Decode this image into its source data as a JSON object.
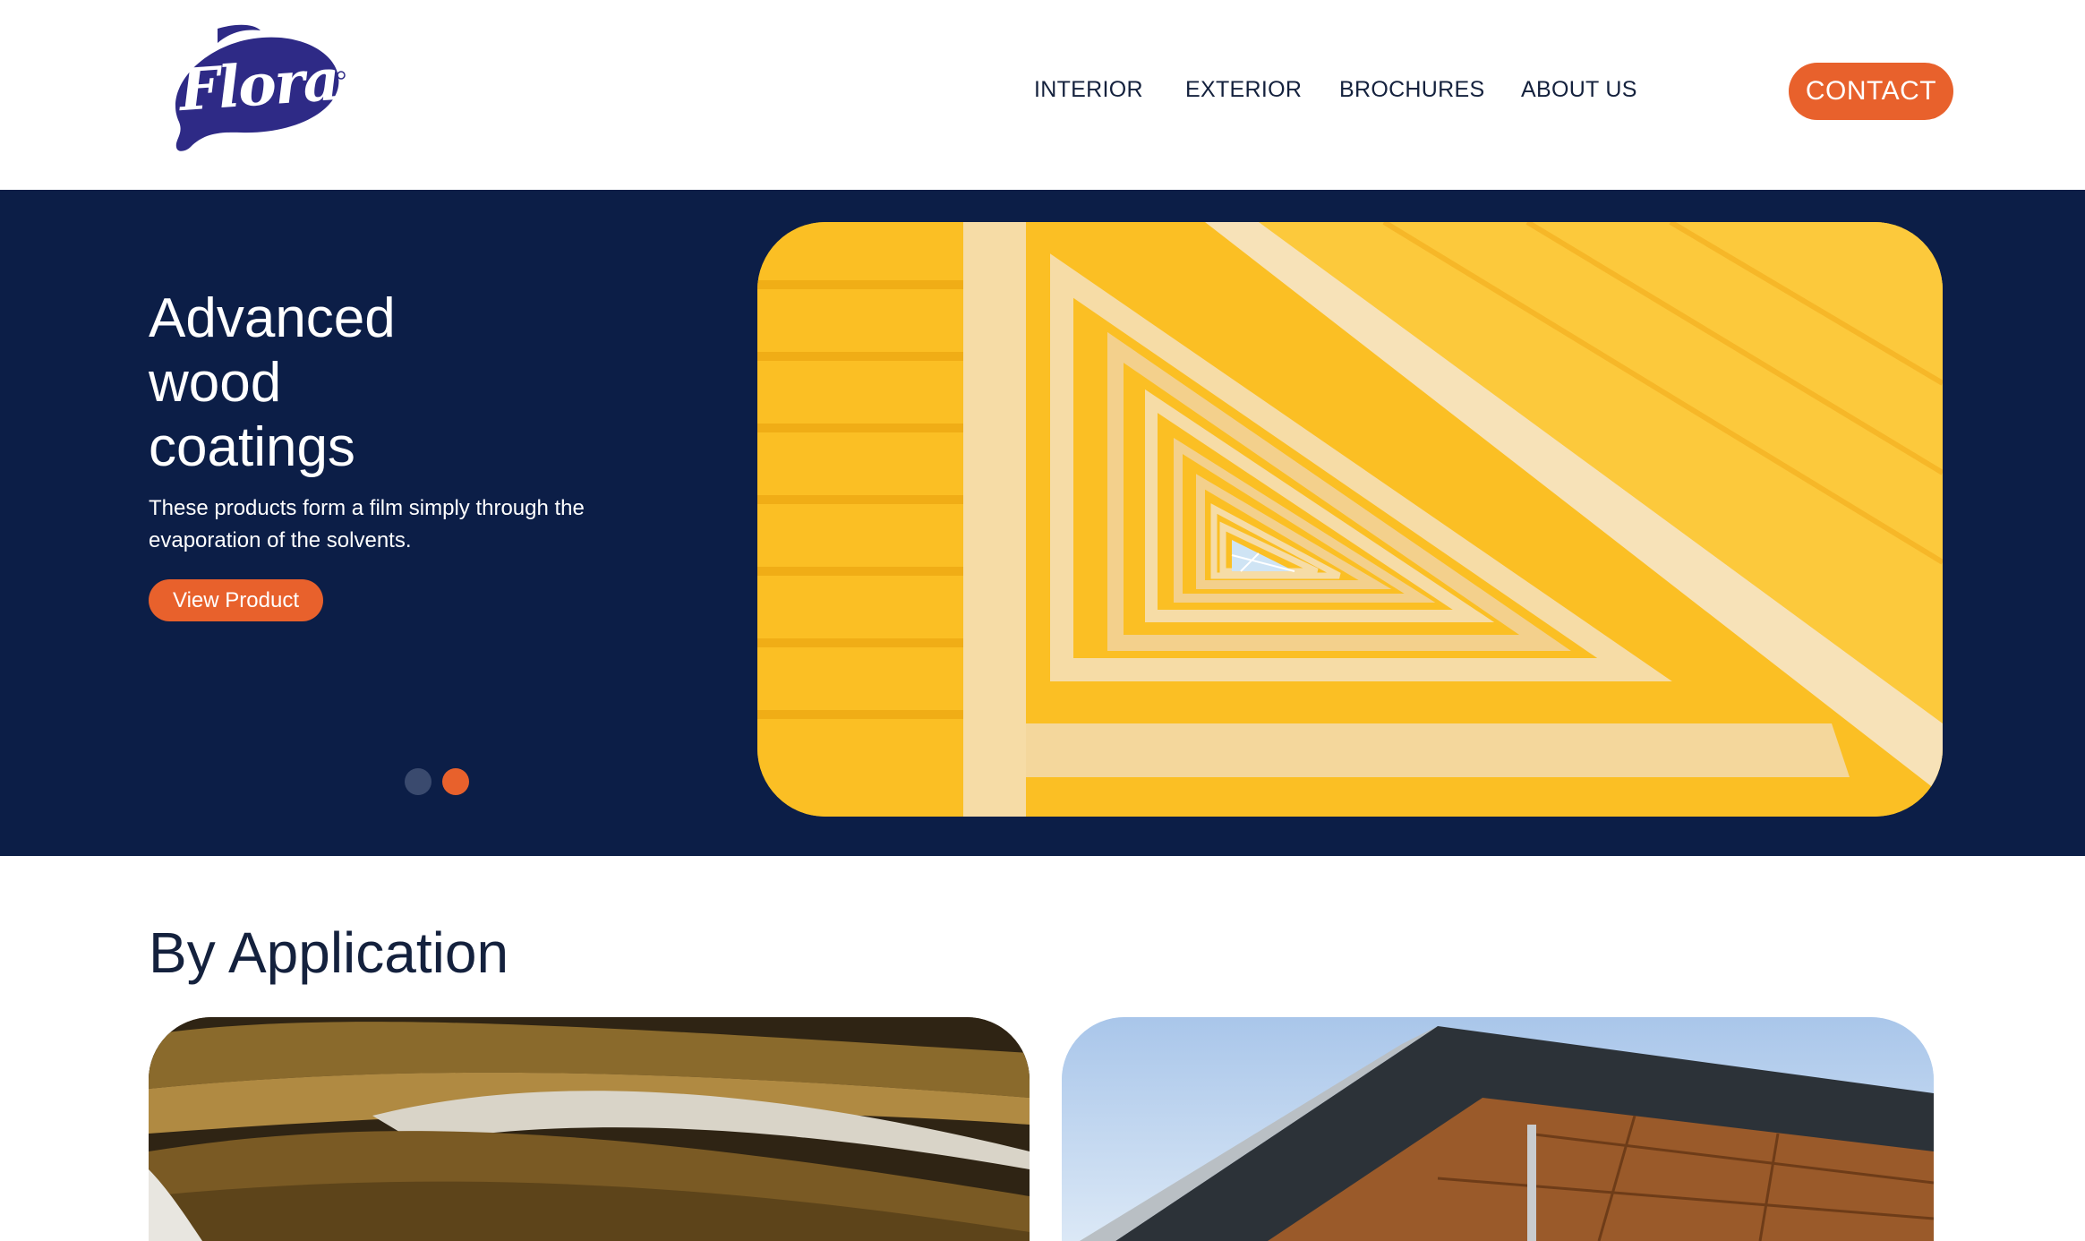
{
  "brand": {
    "logo_text": "Flora"
  },
  "nav": {
    "items": [
      {
        "label": "INTERIOR"
      },
      {
        "label": "EXTERIOR"
      },
      {
        "label": "BROCHURES"
      },
      {
        "label": "ABOUT US"
      }
    ],
    "contact_label": "CONTACT"
  },
  "hero": {
    "title_lines": [
      "Advanced",
      "wood",
      "coatings"
    ],
    "description": "These products form a film simply through the evaporation of the solvents.",
    "button_label": "View Product",
    "slides": {
      "count": 2,
      "active_index": 2
    }
  },
  "section": {
    "title": "By Application"
  },
  "colors": {
    "navy": "#0c1e47",
    "accent_orange": "#e8612c",
    "text_dark": "#14213d",
    "logo_blue": "#2e2a86",
    "hero_yellow": "#fbbf24"
  },
  "icons": {
    "hero_image": "yellow-staircase-image",
    "card_interior": "wooden-atrium-image",
    "card_exterior": "wood-facade-building-image"
  }
}
